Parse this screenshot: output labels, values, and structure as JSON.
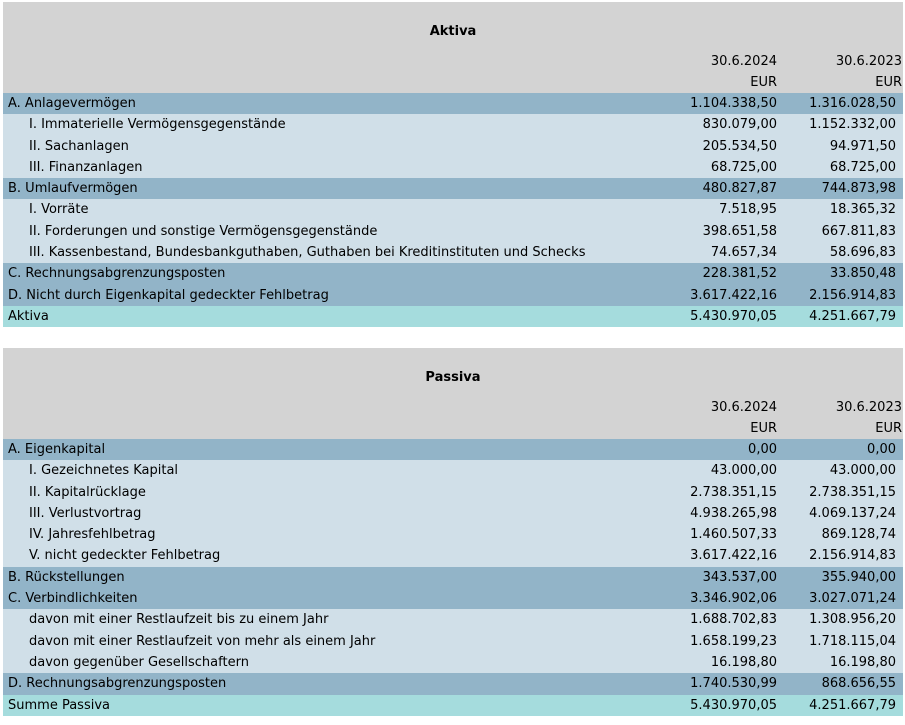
{
  "aktiva": {
    "title": "Aktiva",
    "date1": "30.6.2024",
    "date2": "30.6.2023",
    "cur1": "EUR",
    "cur2": "EUR",
    "rows": [
      {
        "type": "main",
        "label": "A. Anlagevermögen",
        "v1": "1.104.338,50",
        "v2": "1.316.028,50"
      },
      {
        "type": "sub",
        "label": "I. Immaterielle Vermögensgegenstände",
        "v1": "830.079,00",
        "v2": "1.152.332,00"
      },
      {
        "type": "sub",
        "label": "II. Sachanlagen",
        "v1": "205.534,50",
        "v2": "94.971,50"
      },
      {
        "type": "sub",
        "label": "III. Finanzanlagen",
        "v1": "68.725,00",
        "v2": "68.725,00"
      },
      {
        "type": "main",
        "label": "B. Umlaufvermögen",
        "v1": "480.827,87",
        "v2": "744.873,98"
      },
      {
        "type": "sub",
        "label": "I. Vorräte",
        "v1": "7.518,95",
        "v2": "18.365,32"
      },
      {
        "type": "sub",
        "label": "II. Forderungen und sonstige Vermögensgegenstände",
        "v1": "398.651,58",
        "v2": "667.811,83"
      },
      {
        "type": "sub",
        "label": "III. Kassenbestand, Bundesbankguthaben, Guthaben bei Kreditinstituten und Schecks",
        "v1": "74.657,34",
        "v2": "58.696,83"
      },
      {
        "type": "main",
        "label": "C. Rechnungsabgrenzungsposten",
        "v1": "228.381,52",
        "v2": "33.850,48"
      },
      {
        "type": "main",
        "label": "D. Nicht durch Eigenkapital gedeckter Fehlbetrag",
        "v1": "3.617.422,16",
        "v2": "2.156.914,83"
      },
      {
        "type": "total",
        "label": "Aktiva",
        "v1": "5.430.970,05",
        "v2": "4.251.667,79"
      }
    ]
  },
  "passiva": {
    "title": "Passiva",
    "date1": "30.6.2024",
    "date2": "30.6.2023",
    "cur1": "EUR",
    "cur2": "EUR",
    "rows": [
      {
        "type": "main",
        "label": "A. Eigenkapital",
        "v1": "0,00",
        "v2": "0,00"
      },
      {
        "type": "sub",
        "label": "I. Gezeichnetes Kapital",
        "v1": "43.000,00",
        "v2": "43.000,00"
      },
      {
        "type": "sub",
        "label": "II. Kapitalrücklage",
        "v1": "2.738.351,15",
        "v2": "2.738.351,15"
      },
      {
        "type": "sub",
        "label": "III. Verlustvortrag",
        "v1": "4.938.265,98",
        "v2": "4.069.137,24"
      },
      {
        "type": "sub",
        "label": "IV. Jahresfehlbetrag",
        "v1": "1.460.507,33",
        "v2": "869.128,74"
      },
      {
        "type": "sub",
        "label": "V. nicht gedeckter Fehlbetrag",
        "v1": "3.617.422,16",
        "v2": "2.156.914,83"
      },
      {
        "type": "main",
        "label": "B. Rückstellungen",
        "v1": "343.537,00",
        "v2": "355.940,00"
      },
      {
        "type": "main",
        "label": "C. Verbindlichkeiten",
        "v1": "3.346.902,06",
        "v2": "3.027.071,24"
      },
      {
        "type": "sub",
        "label": "davon mit einer Restlaufzeit bis zu einem Jahr",
        "v1": "1.688.702,83",
        "v2": "1.308.956,20"
      },
      {
        "type": "sub",
        "label": "davon mit einer Restlaufzeit von mehr als einem Jahr",
        "v1": "1.658.199,23",
        "v2": "1.718.115,04"
      },
      {
        "type": "sub",
        "label": "davon gegenüber Gesellschaftern",
        "v1": "16.198,80",
        "v2": "16.198,80"
      },
      {
        "type": "main",
        "label": "D. Rechnungsabgrenzungsposten",
        "v1": "1.740.530,99",
        "v2": "868.656,55"
      },
      {
        "type": "total",
        "label": "Summe Passiva",
        "v1": "5.430.970,05",
        "v2": "4.251.667,79"
      }
    ]
  }
}
